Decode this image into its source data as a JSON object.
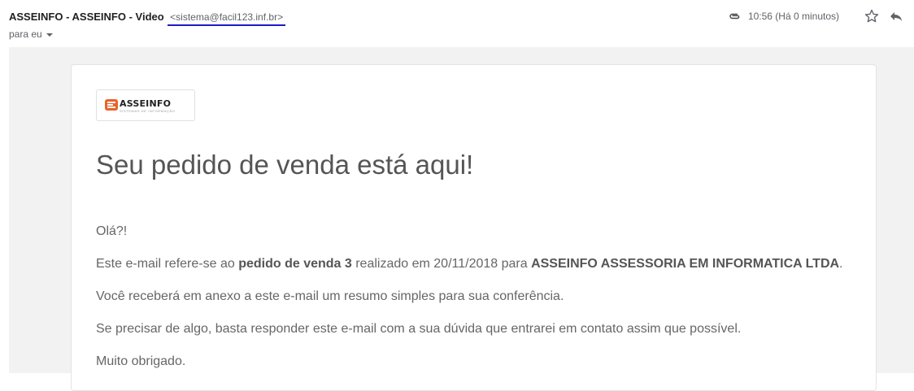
{
  "header": {
    "sender_name": "ASSEINFO - ASSEINFO - Video",
    "sender_email": "<sistema@facil123.inf.br>",
    "to_label": "para eu",
    "time": "10:56 (Há 0 minutos)",
    "icons": [
      "paperclip-icon",
      "star-icon",
      "reply-icon",
      "chevron-down-icon"
    ]
  },
  "email": {
    "logo_text": "ASSEINFO",
    "logo_subtitle": "SISTEMAS DE INFORMAÇÃO",
    "headline": "Seu pedido de venda está aqui!",
    "greeting": "Olá?!",
    "p1_pre": "Este e-mail refere-se ao ",
    "p1_bold1": "pedido de venda 3",
    "p1_mid": " realizado em 20/11/2018 para ",
    "p1_bold2": "ASSEINFO ASSESSORIA EM INFORMATICA LTDA",
    "p1_post": ".",
    "p2": "Você receberá em anexo a este e-mail um resumo simples para sua conferência.",
    "p3": "Se precisar de algo, basta responder este e-mail com a sua dúvida que entrarei em contato assim que possível.",
    "p4": "Muito obrigado."
  },
  "colors": {
    "link_underline": "#1a1acc",
    "logo_orange": "#e8632a",
    "background": "#f2f2f2"
  }
}
